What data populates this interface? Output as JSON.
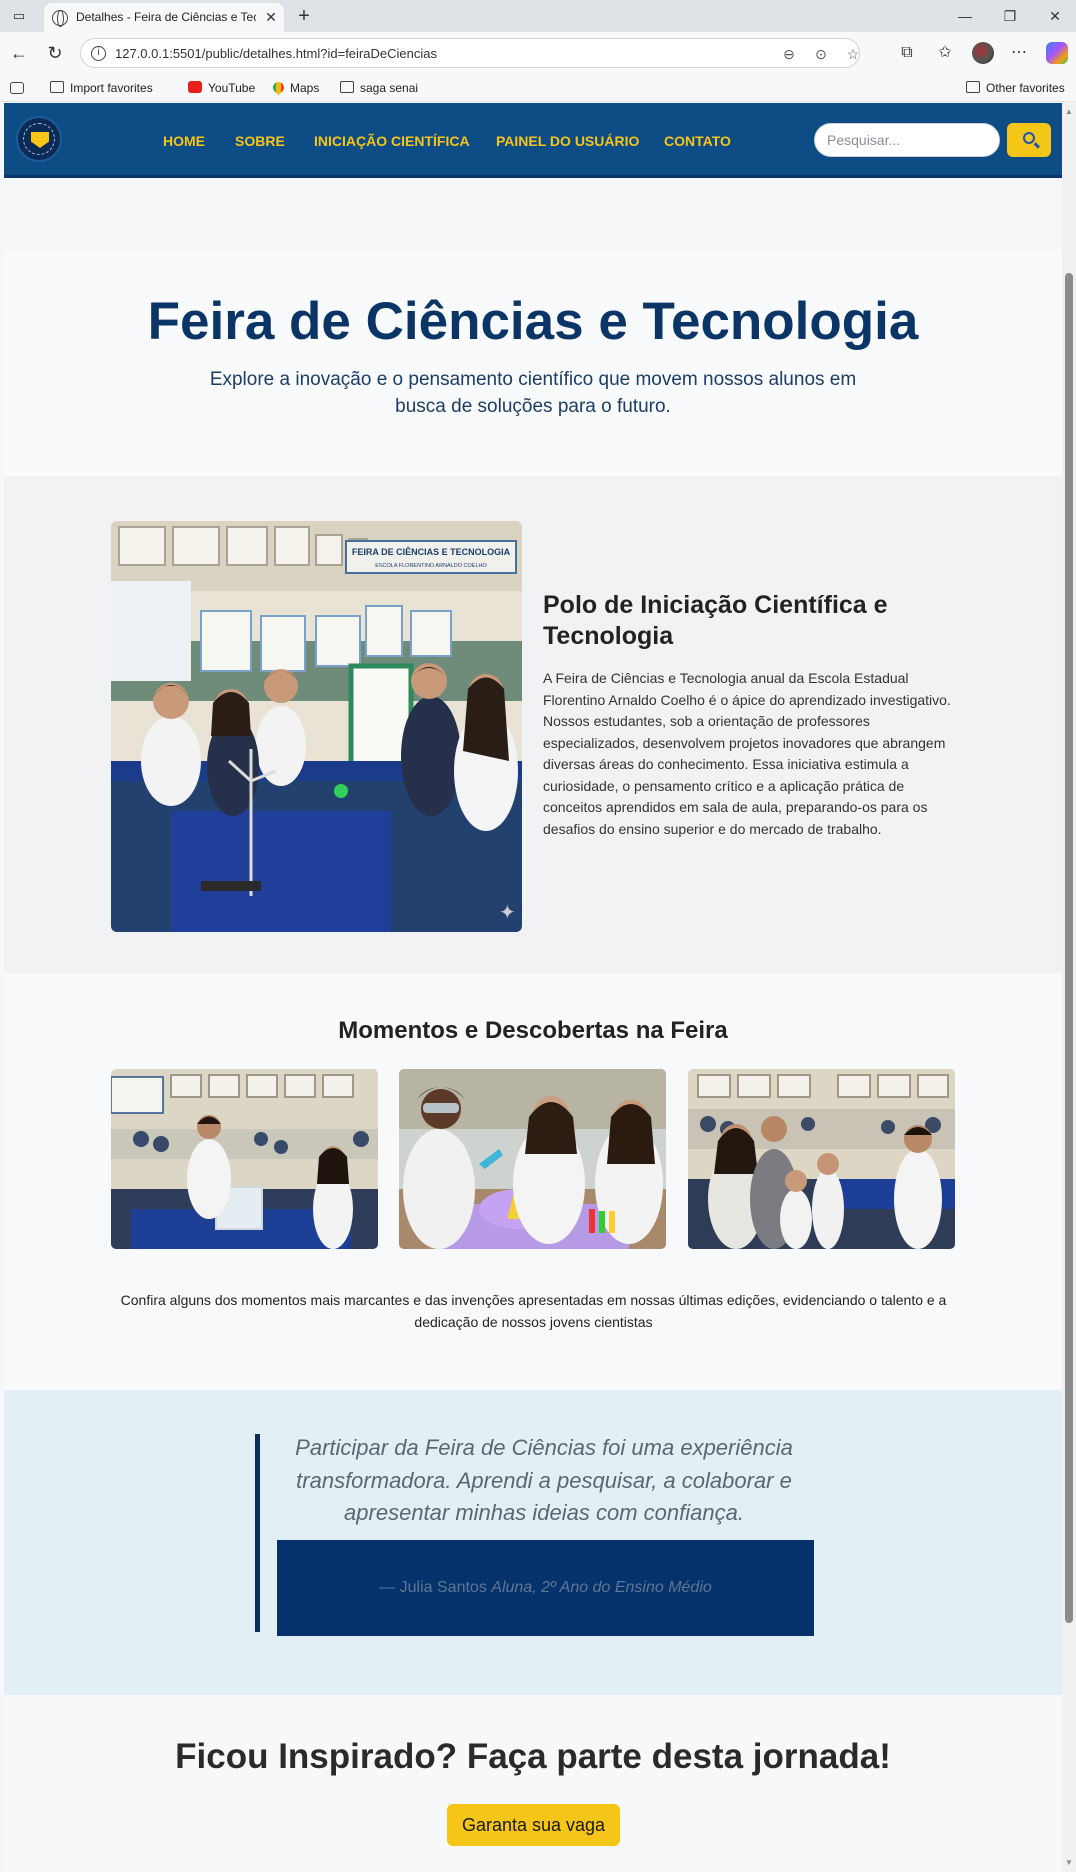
{
  "browser": {
    "tab_title": "Detalhes - Feira de Ciências e Tecnologia",
    "url": "127.0.0.1:5501/public/detalhes.html?id=feiraDeCiencias",
    "bookmarks": [
      "Import favorites",
      "YouTube",
      "Maps",
      "saga senai"
    ],
    "other_favorites": "Other favorites"
  },
  "header": {
    "nav": [
      "HOME",
      "SOBRE",
      "INICIAÇÃO CIENTÍFICA",
      "PAINEL DO USUÁRIO",
      "CONTATO"
    ],
    "search_placeholder": "Pesquisar...",
    "colors": {
      "bar": "#0e4c86",
      "accent": "#f5c518"
    }
  },
  "hero": {
    "title": "Feira de Ciências e Tecnologia",
    "subtitle": "Explore a inovação e o pensamento científico que movem nossos alunos em busca de soluções para o futuro."
  },
  "polo": {
    "title": "Polo de Iniciação Científica e Tecnologia",
    "text": "A Feira de Ciências e Tecnologia anual da Escola Estadual Florentino Arnaldo Coelho é o ápice do aprendizado investigativo. Nossos estudantes, sob a orientação de professores especializados, desenvolvem projetos inovadores que abrangem diversas áreas do conhecimento. Essa iniciativa estimula a curiosidade, o pensamento crítico e a aplicação prática de conceitos aprendidos em sala de aula, preparando-os para os desafios do ensino superior e do mercado de trabalho.",
    "banner_text": "FEIRA DE CIÊNCIAS E TECNOLOGIA",
    "banner_sub": "ESCOLA FLORENTINO ARNALDO COELHO"
  },
  "moments": {
    "title": "Momentos e Descobertas na Feira",
    "text": "Confira alguns dos momentos mais marcantes e das invenções apresentadas em nossas últimas edições, evidenciando o talento e a dedicação de nossos jovens cientistas"
  },
  "testimonial": {
    "quote": "Participar da Feira de Ciências foi uma experiência transformadora. Aprendi a pesquisar, a colaborar e apresentar minhas ideias com confiança.",
    "author": "— Julia Santos",
    "role": "Aluna, 2º Ano do Ensino Médio"
  },
  "cta": {
    "title": "Ficou Inspirado? Faça parte desta jornada!",
    "button": "Garanta sua vaga"
  }
}
